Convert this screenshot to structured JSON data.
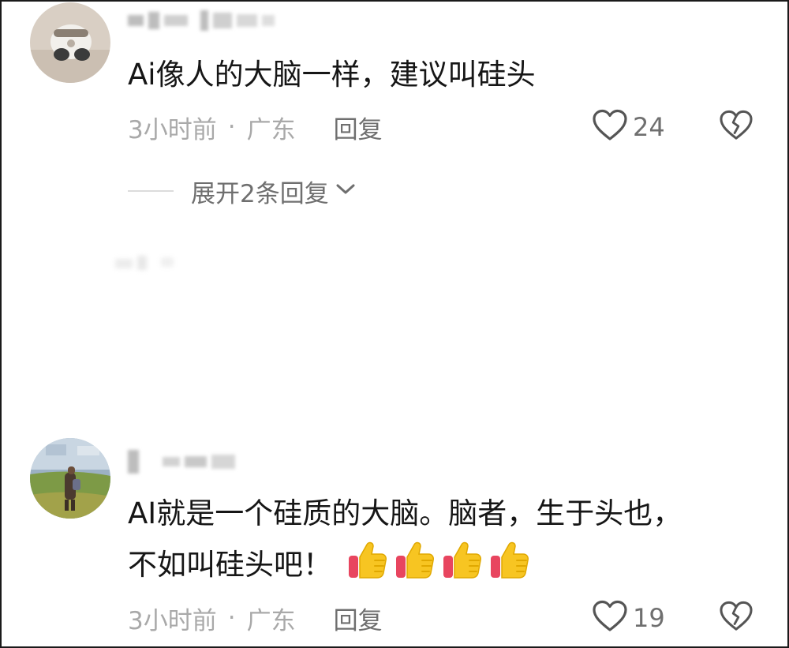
{
  "comments": [
    {
      "content": "Ai像人的大脑一样，建议叫硅头",
      "time": "3小时前",
      "separator": "·",
      "location": "广东",
      "reply_label": "回复",
      "like_count": "24",
      "expand_label": "展开2条回复"
    },
    {
      "content_line1": "AI就是一个硅质的大脑。脑者，生于头也，",
      "content_line2": "不如叫硅头吧！",
      "time": "3小时前",
      "separator": "·",
      "location": "广东",
      "reply_label": "回复",
      "like_count": "19",
      "emojis": [
        "thumbs-up",
        "thumbs-up",
        "thumbs-up",
        "thumbs-up"
      ]
    }
  ],
  "icons": {
    "like": "heart-outline-icon",
    "dislike": "broken-heart-icon",
    "expand": "chevron-down-icon"
  },
  "colors": {
    "text_primary": "#161616",
    "text_secondary": "#a9a9a9",
    "text_action": "#6f6f6f",
    "thumb_yellow": "#f7c522",
    "thumb_red": "#e8455f"
  }
}
